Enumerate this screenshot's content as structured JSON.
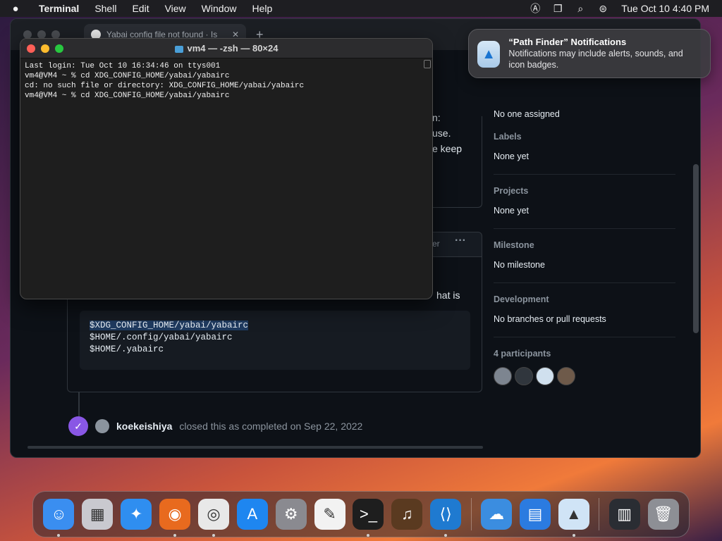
{
  "menubar": {
    "app_name": "Terminal",
    "items": [
      "Shell",
      "Edit",
      "View",
      "Window",
      "Help"
    ],
    "clock": "Tue Oct 10  4:40 PM"
  },
  "browser": {
    "tab_title": "Yabai config file not found · Is",
    "new_tab": "+"
  },
  "github": {
    "assignees_value": "No one assigned",
    "sidebar": [
      {
        "heading": "Labels",
        "value": "None yet"
      },
      {
        "heading": "Projects",
        "value": "None yet"
      },
      {
        "heading": "Milestone",
        "value": "No milestone"
      },
      {
        "heading": "Development",
        "value": "No branches or pull requests"
      }
    ],
    "participants_heading": "4 participants",
    "fragments": {
      "f1": "n:",
      "f2": "use.",
      "f3": "e keep",
      "f4": "er",
      "f5": "hat is",
      "more": "···"
    },
    "code_lines": [
      "$XDG_CONFIG_HOME/yabai/yabairc",
      "$HOME/.config/yabai/yabairc",
      "$HOME/.yabairc"
    ],
    "event": {
      "user": "koekeishiya",
      "text": "closed this as completed on Sep 22, 2022"
    }
  },
  "terminal": {
    "title": "vm4 — -zsh — 80×24",
    "lines": [
      "Last login: Tue Oct 10 16:34:46 on ttys001",
      "vm4@VM4 ~ % cd XDG_CONFIG_HOME/yabai/yabairc",
      "cd: no such file or directory: XDG_CONFIG_HOME/yabai/yabairc",
      "vm4@VM4 ~ % cd XDG_CONFIG_HOME/yabai/yabairc"
    ]
  },
  "notification": {
    "title": "“Path Finder” Notifications",
    "body": "Notifications may include alerts, sounds, and icon badges."
  },
  "dock": {
    "apps": [
      {
        "name": "finder-icon",
        "color": "#3a8ef0",
        "glyph": "☺",
        "running": true
      },
      {
        "name": "launchpad-icon",
        "color": "#c9c9cf",
        "glyph": "▦",
        "running": false
      },
      {
        "name": "safari-icon",
        "color": "#2f8ef0",
        "glyph": "✦",
        "running": false
      },
      {
        "name": "firefox-icon",
        "color": "#e86a1e",
        "glyph": "◉",
        "running": true
      },
      {
        "name": "chrome-icon",
        "color": "#e8e8e8",
        "glyph": "◎",
        "running": true
      },
      {
        "name": "app-store-icon",
        "color": "#1e86f0",
        "glyph": "A",
        "running": false
      },
      {
        "name": "system-settings-icon",
        "color": "#8a8a90",
        "glyph": "⚙",
        "running": false
      },
      {
        "name": "textedit-icon",
        "color": "#f2f2f2",
        "glyph": "✎",
        "running": false
      },
      {
        "name": "terminal-icon",
        "color": "#1e1e1e",
        "glyph": ">_",
        "running": true
      },
      {
        "name": "garageband-icon",
        "color": "#5a3a20",
        "glyph": "♫",
        "running": false
      },
      {
        "name": "vscode-icon",
        "color": "#1f7ad0",
        "glyph": "⟨⟩",
        "running": true
      }
    ],
    "apps_right": [
      {
        "name": "weather-icon",
        "color": "#3b8de0",
        "glyph": "☁",
        "running": false
      },
      {
        "name": "files-icon",
        "color": "#2b7be0",
        "glyph": "▤",
        "running": false
      },
      {
        "name": "path-finder-icon",
        "color": "#d0e4f6",
        "glyph": "▲",
        "running": true
      }
    ],
    "apps_trash": [
      {
        "name": "minimized-window-icon",
        "color": "#2a2d33",
        "glyph": "▥",
        "running": false
      },
      {
        "name": "trash-icon",
        "color": "#8d8f95",
        "glyph": "🗑",
        "running": false
      }
    ]
  }
}
